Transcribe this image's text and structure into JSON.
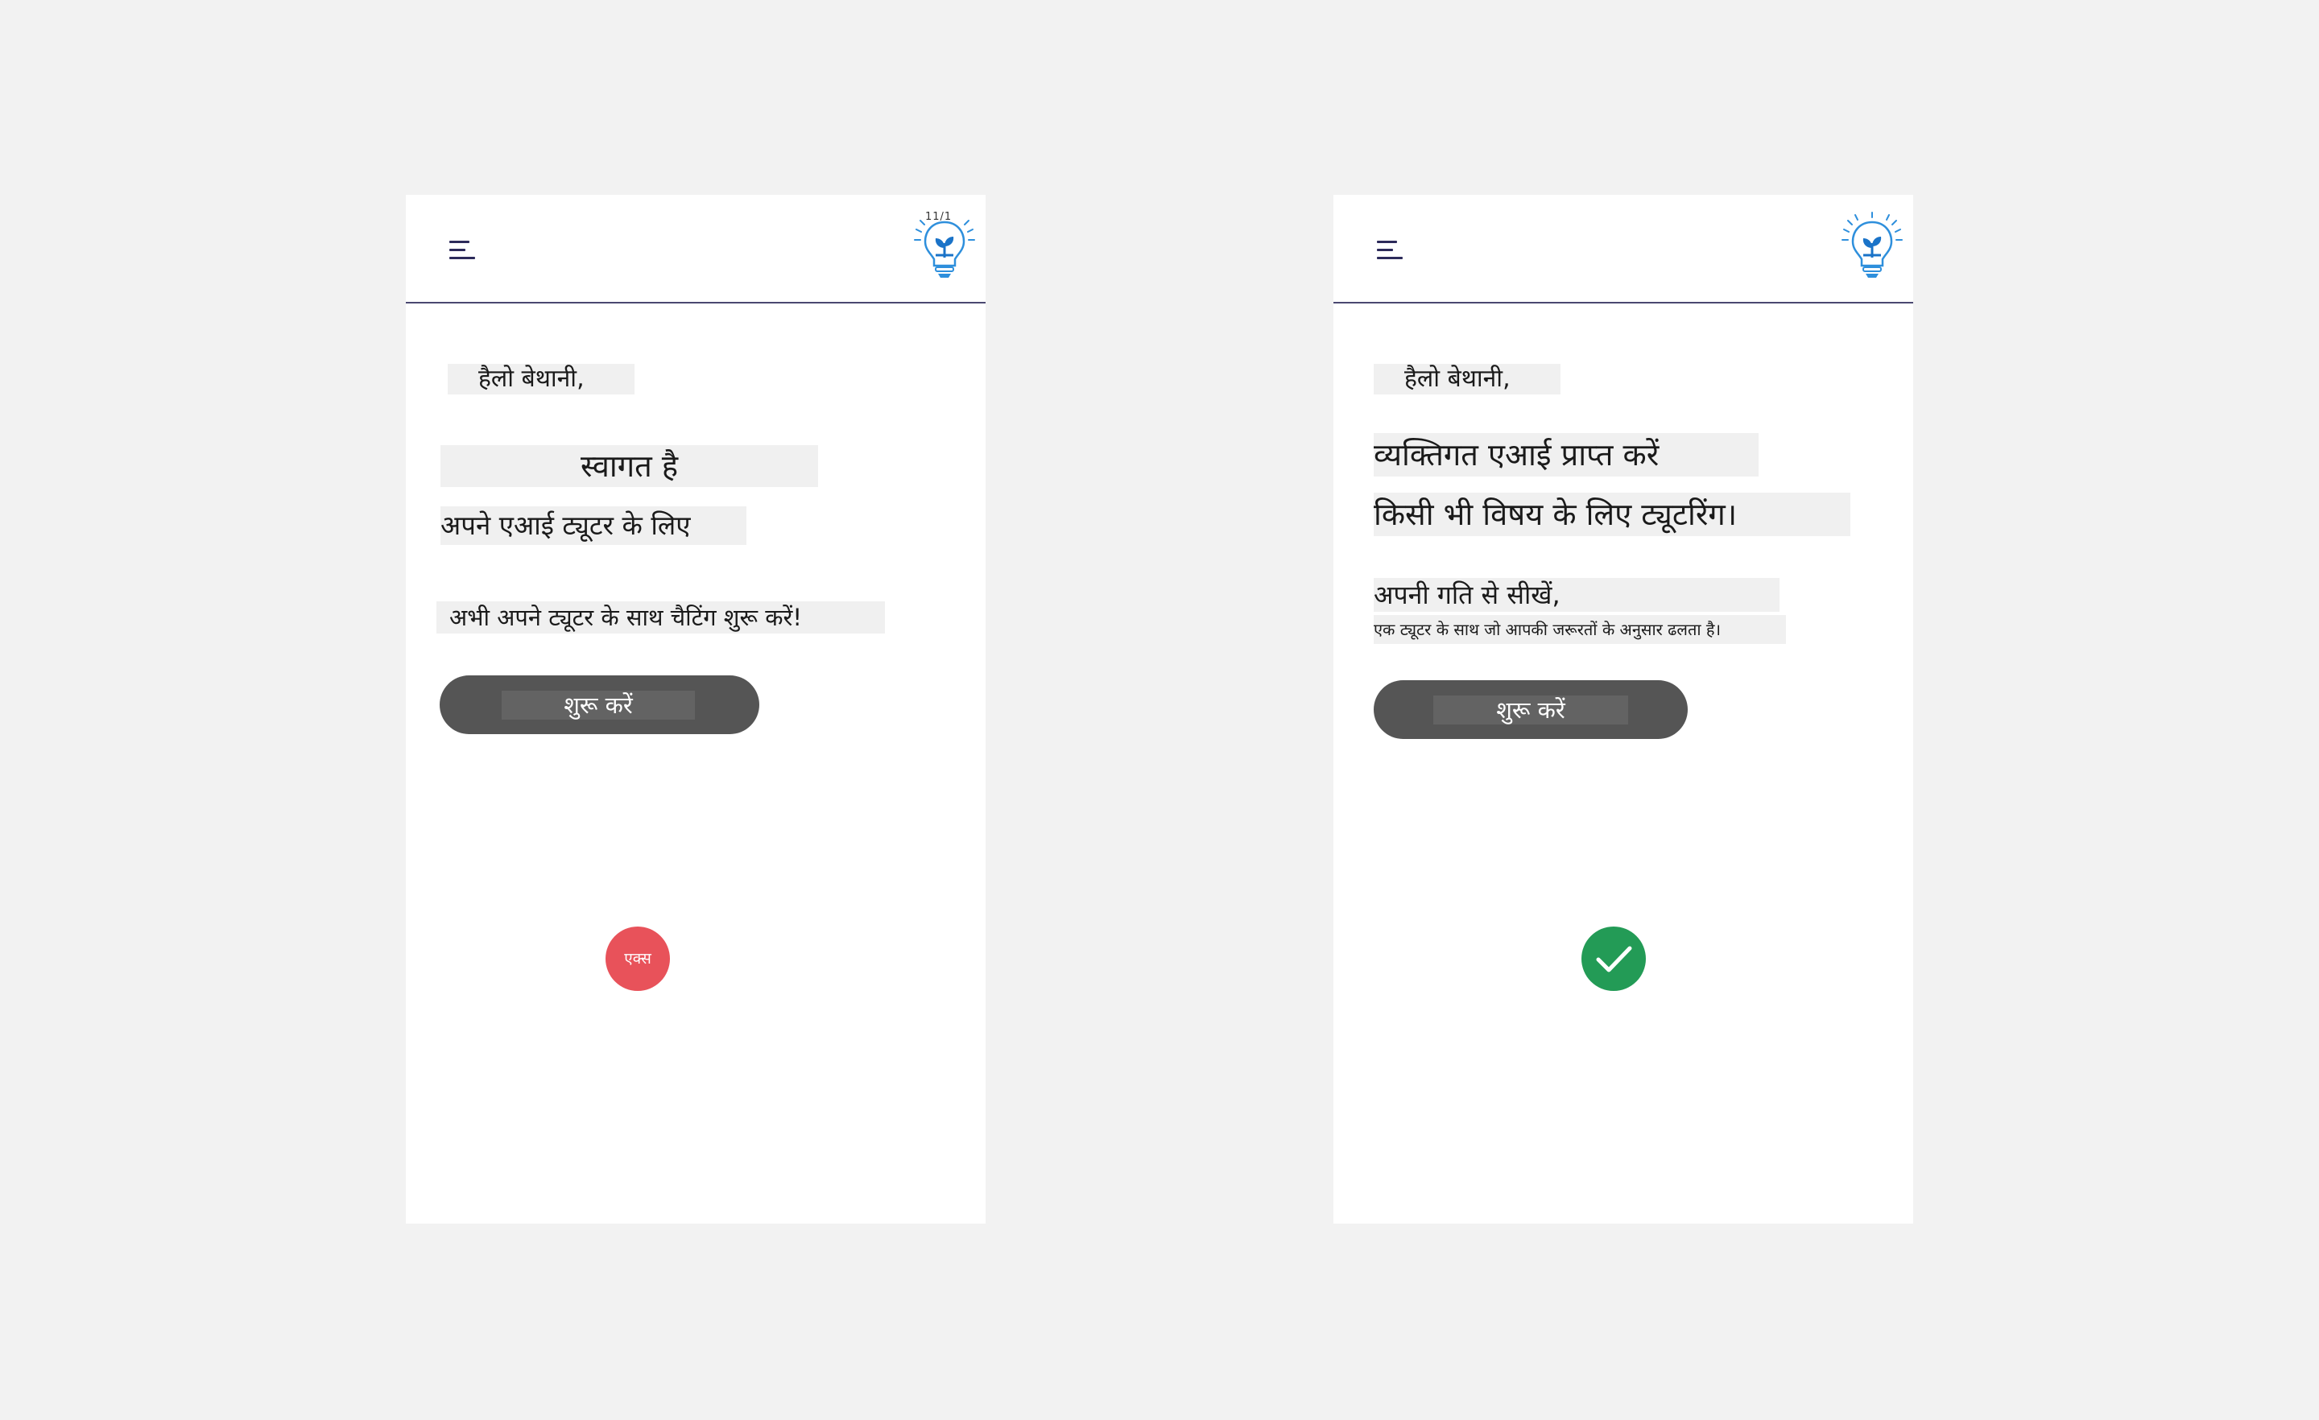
{
  "left_screen": {
    "greeting": "हैलो बेथानी,",
    "welcome": "स्वागत है",
    "for_ai_tutor": "अपने एआई ट्यूटर के लिए",
    "chat_prompt": "अभी अपने ट्यूटर के साथ चैटिंग शुरू करें!",
    "start_button": "शुरू करें",
    "verdict_label": "एक्स",
    "logo_mark": "11/1"
  },
  "right_screen": {
    "greeting": "हैलो बेथानी,",
    "headline_line1": "व्यक्तिगत एआई प्राप्त करें",
    "headline_line2": "किसी भी विषय के लिए ट्यूटरिंग।",
    "subheading": "अपनी गति से सीखें,",
    "subtext": "एक ट्यूटर के साथ जो आपकी जरूरतों के अनुसार ढलता है।",
    "start_button": "शुरू करें"
  },
  "icons": {
    "menu": "hamburger-menu-icon",
    "logo": "lightbulb-plant-icon",
    "wrong": "x-icon",
    "correct": "checkmark-icon"
  },
  "colors": {
    "page_background": "#f2f2f2",
    "header_divider": "#4a4870",
    "button": "#555555",
    "wrong": "#e8525a",
    "correct": "#239b56",
    "logo_accent": "#2e8fdc"
  }
}
